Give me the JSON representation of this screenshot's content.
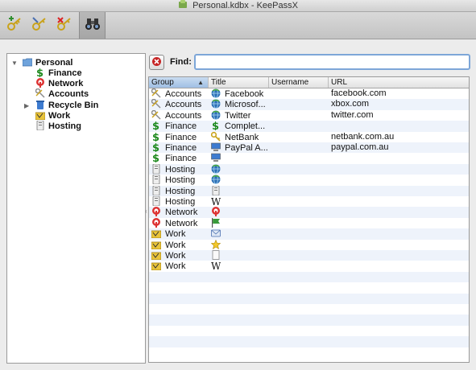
{
  "window": {
    "title": "Personal.kdbx - KeePassX"
  },
  "toolbar": {
    "buttons": [
      {
        "name": "add-entry-button",
        "icon": "key-add-icon"
      },
      {
        "name": "edit-entry-button",
        "icon": "key-edit-icon"
      },
      {
        "name": "delete-entry-button",
        "icon": "key-delete-icon"
      },
      {
        "name": "search-button",
        "icon": "binoculars-icon",
        "active": true
      }
    ]
  },
  "tree": {
    "root": {
      "label": "Personal",
      "icon": "folder-icon"
    },
    "items": [
      {
        "label": "Finance",
        "icon": "dollar-icon"
      },
      {
        "label": "Network",
        "icon": "network-icon"
      },
      {
        "label": "Accounts",
        "icon": "keys-icon"
      },
      {
        "label": "Recycle Bin",
        "icon": "recycle-bin-icon",
        "collapsed": true
      },
      {
        "label": "Work",
        "icon": "work-icon"
      },
      {
        "label": "Hosting",
        "icon": "server-icon"
      }
    ]
  },
  "find": {
    "label": "Find:",
    "value": ""
  },
  "table": {
    "columns": [
      "Group",
      "Title",
      "Username",
      "URL"
    ],
    "sorted_column": "Group",
    "rows": [
      {
        "group": "Accounts",
        "group_icon": "keys-icon",
        "title": "Facebook",
        "title_icon": "globe-icon",
        "username": "",
        "url": "facebook.com"
      },
      {
        "group": "Accounts",
        "group_icon": "keys-icon",
        "title": "Microsof...",
        "title_icon": "globe-icon",
        "username": "",
        "url": "xbox.com"
      },
      {
        "group": "Accounts",
        "group_icon": "keys-icon",
        "title": "Twitter",
        "title_icon": "globe-icon",
        "username": "",
        "url": "twitter.com"
      },
      {
        "group": "Finance",
        "group_icon": "dollar-icon",
        "title": "Complet...",
        "title_icon": "dollar-icon",
        "username": "",
        "url": ""
      },
      {
        "group": "Finance",
        "group_icon": "dollar-icon",
        "title": "NetBank",
        "title_icon": "key-icon",
        "username": "",
        "url": "netbank.com.au"
      },
      {
        "group": "Finance",
        "group_icon": "dollar-icon",
        "title": "PayPal A...",
        "title_icon": "computer-icon",
        "username": "",
        "url": "paypal.com.au"
      },
      {
        "group": "Finance",
        "group_icon": "dollar-icon",
        "title": "",
        "title_icon": "computer-icon",
        "username": "",
        "url": ""
      },
      {
        "group": "Hosting",
        "group_icon": "server-icon",
        "title": "",
        "title_icon": "globe-icon",
        "username": "",
        "url": ""
      },
      {
        "group": "Hosting",
        "group_icon": "server-icon",
        "title": "",
        "title_icon": "globe-icon",
        "username": "",
        "url": ""
      },
      {
        "group": "Hosting",
        "group_icon": "server-icon",
        "title": "",
        "title_icon": "server-icon",
        "username": "",
        "url": ""
      },
      {
        "group": "Hosting",
        "group_icon": "server-icon",
        "title": "",
        "title_icon": "wikipedia-icon",
        "username": "",
        "url": ""
      },
      {
        "group": "Network",
        "group_icon": "network-icon",
        "title": "",
        "title_icon": "network-icon",
        "username": "",
        "url": ""
      },
      {
        "group": "Network",
        "group_icon": "network-icon",
        "title": "",
        "title_icon": "flag-icon",
        "username": "",
        "url": ""
      },
      {
        "group": "Work",
        "group_icon": "work-icon",
        "title": "",
        "title_icon": "mail-icon",
        "username": "",
        "url": ""
      },
      {
        "group": "Work",
        "group_icon": "work-icon",
        "title": "",
        "title_icon": "star-icon",
        "username": "",
        "url": ""
      },
      {
        "group": "Work",
        "group_icon": "work-icon",
        "title": "",
        "title_icon": "document-icon",
        "username": "",
        "url": ""
      },
      {
        "group": "Work",
        "group_icon": "work-icon",
        "title": "",
        "title_icon": "wikipedia-icon",
        "username": "",
        "url": ""
      }
    ]
  },
  "colors": {
    "selection_header": "#a8c6ea",
    "alt_row": "#eef3fb",
    "find_border": "#7da6d8"
  }
}
